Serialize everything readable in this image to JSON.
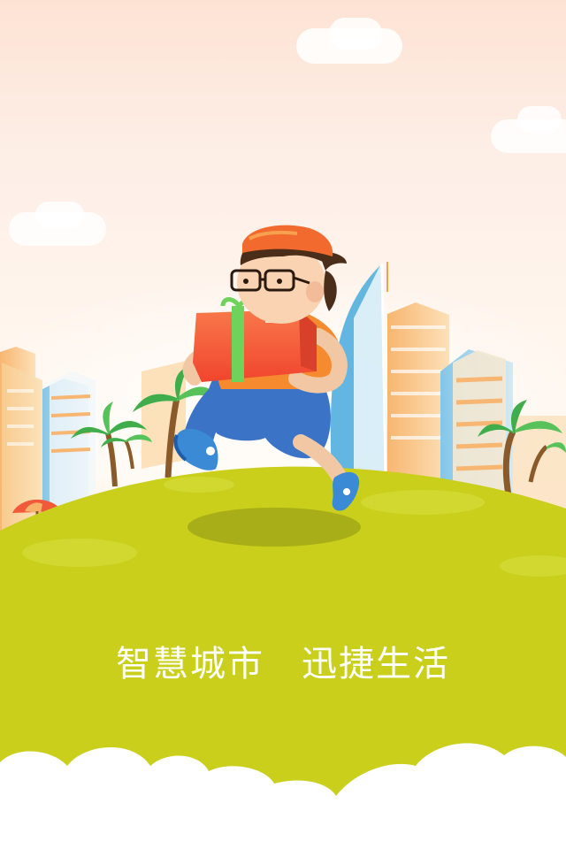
{
  "splash": {
    "slogan": "智慧城市　迅捷生活"
  },
  "colors": {
    "sky_top": "#fde3d4",
    "sky_bottom": "#fff6ee",
    "hill_green": "#c8ce1a",
    "hill_light": "#cdd320",
    "cap_orange": "#f26a2e",
    "package_red": "#f35a3a",
    "ribbon_green": "#6fd25a",
    "shorts_blue": "#3b74c6",
    "shoe_blue": "#3a8ad6",
    "cloud_white": "#ffffff"
  }
}
